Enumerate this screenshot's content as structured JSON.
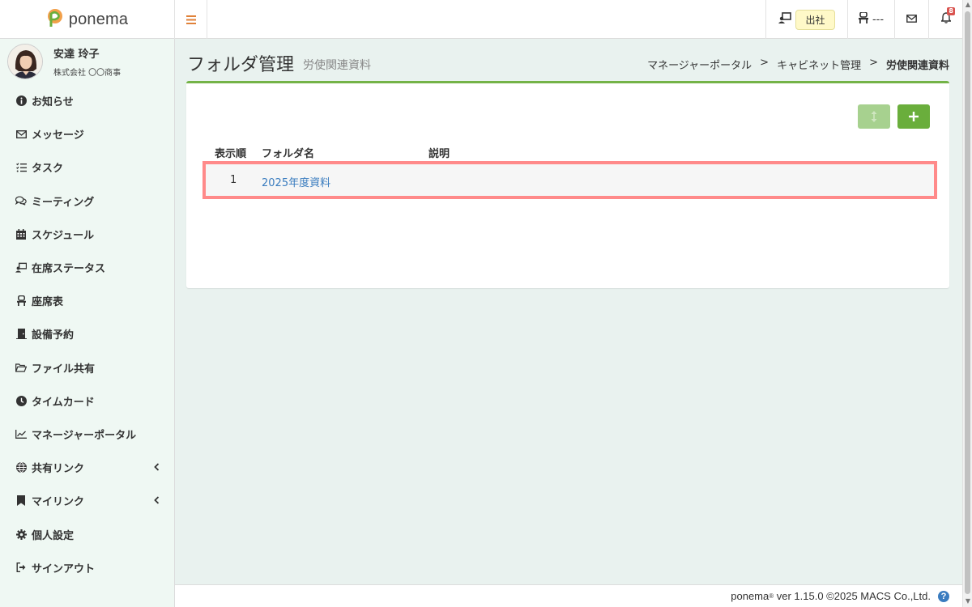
{
  "brand": {
    "name": "ponema"
  },
  "topbar": {
    "attendance_label": "出社",
    "seat_label": "---",
    "notification_count": "8"
  },
  "user": {
    "name": "安達 玲子",
    "company": "株式会社 〇〇商事"
  },
  "sidebar": {
    "items": [
      {
        "label": "お知らせ",
        "icon": "info-circle-icon"
      },
      {
        "label": "メッセージ",
        "icon": "envelope-icon"
      },
      {
        "label": "タスク",
        "icon": "task-list-icon"
      },
      {
        "label": "ミーティング",
        "icon": "chat-bubbles-icon"
      },
      {
        "label": "スケジュール",
        "icon": "calendar-icon"
      },
      {
        "label": "在席ステータス",
        "icon": "presence-icon"
      },
      {
        "label": "座席表",
        "icon": "chair-icon"
      },
      {
        "label": "設備予約",
        "icon": "door-icon"
      },
      {
        "label": "ファイル共有",
        "icon": "folder-open-icon"
      },
      {
        "label": "タイムカード",
        "icon": "clock-icon"
      },
      {
        "label": "マネージャーポータル",
        "icon": "line-chart-icon"
      },
      {
        "label": "共有リンク",
        "icon": "globe-icon"
      },
      {
        "label": "マイリンク",
        "icon": "bookmark-icon"
      },
      {
        "label": "個人設定",
        "icon": "gear-icon"
      },
      {
        "label": "サインアウト",
        "icon": "sign-out-icon"
      }
    ]
  },
  "page": {
    "title": "フォルダ管理",
    "subtitle": "労使関連資料"
  },
  "breadcrumb": {
    "items": [
      "マネージャーポータル",
      "キャビネット管理",
      "労使関連資料"
    ],
    "separator": ">"
  },
  "table": {
    "headers": {
      "order": "表示順",
      "name": "フォルダ名",
      "description": "説明"
    },
    "rows": [
      {
        "order": "1",
        "name": "2025年度資料",
        "description": ""
      }
    ]
  },
  "footer": {
    "product": "ponema",
    "reg_mark": "®",
    "version_text": " ver 1.15.0 ©2025 MACS Co.,Ltd.",
    "help_label": "?"
  },
  "colors": {
    "accent_green": "#6aae3c",
    "panel_border_green": "#74b347",
    "link_blue": "#3a7cbf",
    "highlight_red": "#ff8a8a",
    "sidebar_bg": "#eff8f3",
    "content_bg": "#e9f2ef",
    "attendance_yellow": "#fff9c8"
  }
}
